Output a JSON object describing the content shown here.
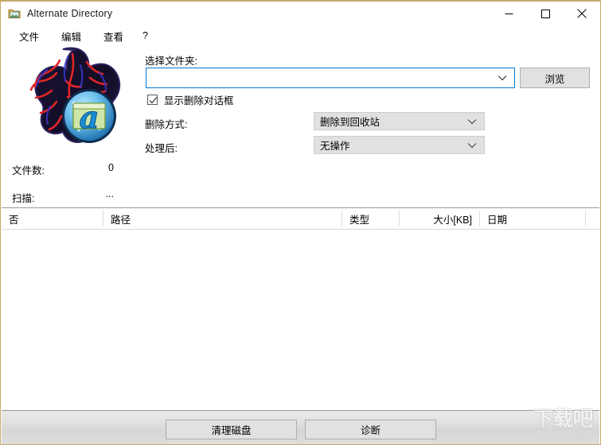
{
  "window": {
    "title": "Alternate Directory",
    "icon": "folder-picture-icon",
    "controls": {
      "minimize": "minimize-icon",
      "maximize": "maximize-icon",
      "close": "close-icon"
    }
  },
  "menubar": {
    "items": [
      {
        "label": "文件"
      },
      {
        "label": "编辑"
      },
      {
        "label": "查看"
      },
      {
        "label": "?"
      }
    ]
  },
  "form": {
    "folder_label": "选择文件夹:",
    "folder_value": "",
    "folder_placeholder": "",
    "browse_button": "浏览",
    "show_delete_dialog": {
      "label": "显示删除对话框",
      "checked": "true"
    },
    "delete_mode_label": "删除方式:",
    "delete_mode_value": "删除到回收站",
    "after_label": "处理后:",
    "after_value": "无操作"
  },
  "stats": {
    "file_count_label": "文件数:",
    "file_count_value": "0",
    "scan_label": "扫描:",
    "scan_value": "..."
  },
  "listview": {
    "columns": [
      {
        "label": "否",
        "align": "left"
      },
      {
        "label": "路径",
        "align": "left"
      },
      {
        "label": "类型",
        "align": "left"
      },
      {
        "label": "大小[KB]",
        "align": "right"
      },
      {
        "label": "日期",
        "align": "left"
      }
    ],
    "rows": []
  },
  "bottom": {
    "clean_button": "清理磁盘",
    "diagnose_button": "诊断"
  },
  "watermark": {
    "glyphs": "下载吧",
    "url": "www.xiazaiba.com"
  },
  "colors": {
    "window_border": "#c7a96b",
    "focus_border": "#0078d7",
    "button_face": "#e1e1e1",
    "button_border": "#adadad",
    "combo_flat": "#e1e1e1",
    "header_rule": "#9a9a9a"
  }
}
